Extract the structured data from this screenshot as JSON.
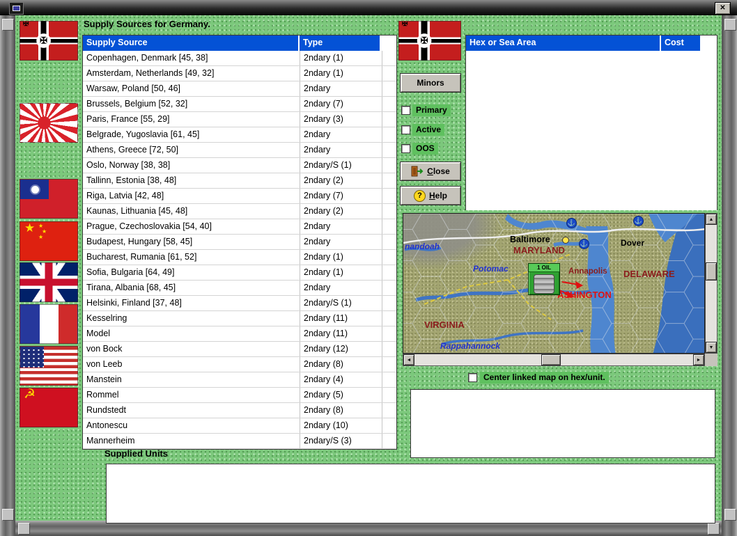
{
  "window": {
    "close_glyph": "✕"
  },
  "page": {
    "title": "Supply Sources for Germany."
  },
  "flags": {
    "countries": [
      "Germany",
      "Japan",
      "Nationalist China",
      "Communist China",
      "United Kingdom",
      "France",
      "United States",
      "Soviet Union"
    ],
    "selected": "Germany"
  },
  "supply_table": {
    "headers": [
      "Supply Source",
      "Type"
    ],
    "rows": [
      [
        "Copenhagen, Denmark [45, 38]",
        "2ndary (1)"
      ],
      [
        "Amsterdam, Netherlands [49, 32]",
        "2ndary (1)"
      ],
      [
        "Warsaw, Poland [50, 46]",
        "2ndary"
      ],
      [
        "Brussels, Belgium [52, 32]",
        "2ndary (7)"
      ],
      [
        "Paris, France [55, 29]",
        "2ndary (3)"
      ],
      [
        "Belgrade, Yugoslavia [61, 45]",
        "2ndary"
      ],
      [
        "Athens, Greece [72, 50]",
        "2ndary"
      ],
      [
        "Oslo, Norway [38, 38]",
        "2ndary/S (1)"
      ],
      [
        "Tallinn, Estonia [38, 48]",
        "2ndary (2)"
      ],
      [
        "Riga, Latvia [42, 48]",
        "2ndary (7)"
      ],
      [
        "Kaunas, Lithuania [45, 48]",
        "2ndary (2)"
      ],
      [
        "Prague, Czechoslovakia [54, 40]",
        "2ndary"
      ],
      [
        "Budapest, Hungary [58, 45]",
        "2ndary"
      ],
      [
        "Bucharest, Rumania [61, 52]",
        "2ndary (1)"
      ],
      [
        "Sofia, Bulgaria [64, 49]",
        "2ndary (1)"
      ],
      [
        "Tirana, Albania [68, 45]",
        "2ndary"
      ],
      [
        "Helsinki, Finland [37, 48]",
        "2ndary/S (1)"
      ],
      [
        "Kesselring",
        "2ndary (11)"
      ],
      [
        "Model",
        "2ndary (11)"
      ],
      [
        "von Bock",
        "2ndary (12)"
      ],
      [
        "von Leeb",
        "2ndary (8)"
      ],
      [
        "Manstein",
        "2ndary (4)"
      ],
      [
        "Rommel",
        "2ndary (5)"
      ],
      [
        "Rundstedt",
        "2ndary (8)"
      ],
      [
        "Antonescu",
        "2ndary (10)"
      ],
      [
        "Mannerheim",
        "2ndary/S (3)"
      ]
    ]
  },
  "controls": {
    "minors_label": "Minors",
    "checkboxes": [
      {
        "label": "Primary",
        "checked": false
      },
      {
        "label": "Active",
        "checked": false
      },
      {
        "label": "OOS",
        "checked": false
      }
    ],
    "close_label": "Close",
    "help_label": "Help"
  },
  "hex_table": {
    "headers": [
      "Hex or Sea Area",
      "Cost"
    ],
    "rows": []
  },
  "map": {
    "unit": {
      "label": "1 OIL"
    },
    "labels": [
      {
        "text": "nandoah"
      },
      {
        "text": "Baltimore"
      },
      {
        "text": "MARYLAND"
      },
      {
        "text": "Potomac"
      },
      {
        "text": "Dover"
      },
      {
        "text": "Annapolis"
      },
      {
        "text": "DELAWARE"
      },
      {
        "text": "ASHINGTON"
      },
      {
        "text": "VIRGINIA"
      },
      {
        "text": "Rappahannock"
      }
    ],
    "center_checkbox": {
      "label": "Center linked map on hex/unit.",
      "checked": false
    }
  },
  "supplied_units": {
    "label": "Supplied Units"
  },
  "icons": {
    "anchor": "⚓",
    "help": "?",
    "maltese_cross": "✠",
    "hammer_sickle": "☭",
    "star": "★",
    "arrow_up": "▲",
    "arrow_down": "▼",
    "arrow_left": "◄",
    "arrow_right": "►"
  },
  "colors": {
    "header_blue": "#0452d6",
    "background_green": "#7cc87c",
    "label_green": "#5fc05f",
    "map_red": "#e01010",
    "map_dark_red": "#8b1c1c",
    "map_water_blue": "#4e86cf"
  }
}
